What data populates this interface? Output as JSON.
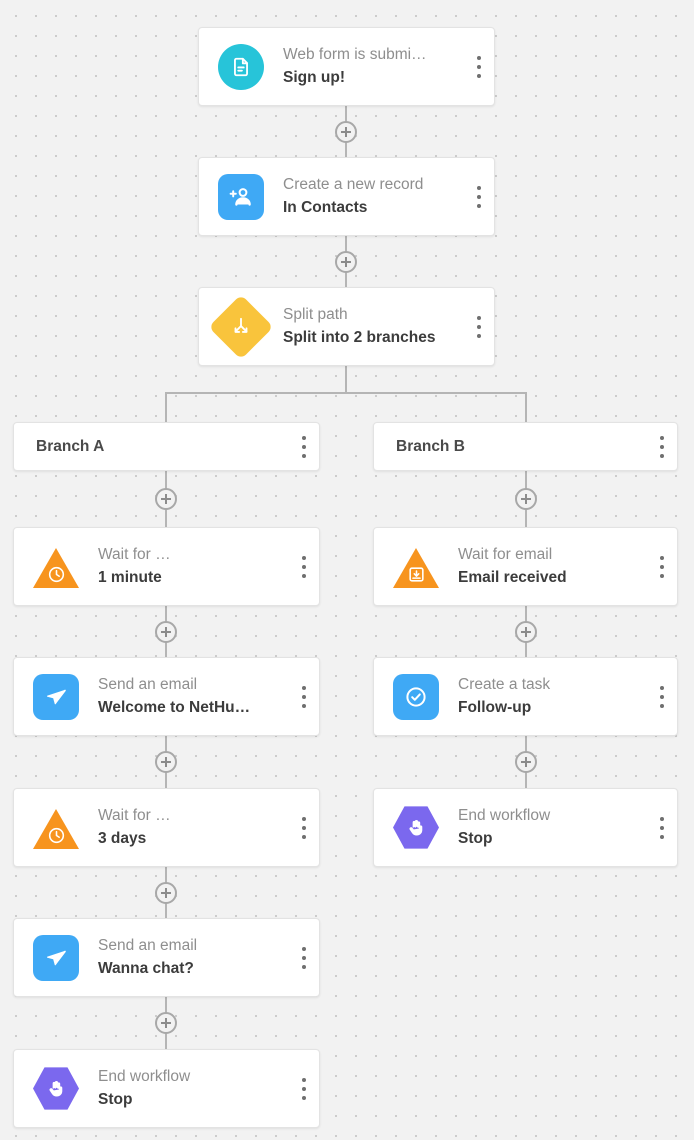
{
  "canvas": {
    "background_color": "#f2f2f2",
    "dot_color": "#c9c9c9",
    "connector_color": "#b5b5b5"
  },
  "icon_colors": {
    "web_form": "#27c4d9",
    "record": "#3fa9f5",
    "split": "#f9c council",
    "split_path": "#f9c43c",
    "wait": "#f7941e",
    "email": "#3fa9f5",
    "task": "#3fa9f5",
    "end": "#7b68ee"
  },
  "trunk": {
    "nodes": [
      {
        "id": "web-form",
        "subtitle": "Web form is submi…",
        "title": "Sign up!",
        "icon": "document-icon",
        "icon_shape": "circle",
        "icon_color": "#27c4d9"
      },
      {
        "id": "create-record",
        "subtitle": "Create a new record",
        "title": "In Contacts",
        "icon": "add-person-icon",
        "icon_shape": "rounded-square",
        "icon_color": "#3fa9f5"
      },
      {
        "id": "split-path",
        "subtitle": "Split path",
        "title": "Split into 2 branches",
        "icon": "split-arrows-icon",
        "icon_shape": "diamond",
        "icon_color": "#f9c43c"
      }
    ]
  },
  "branches": [
    {
      "id": "branch-a",
      "label": "Branch A",
      "nodes": [
        {
          "id": "wait-1-minute",
          "subtitle": "Wait for …",
          "title": "1 minute",
          "icon": "clock-icon",
          "icon_shape": "triangle",
          "icon_color": "#f7941e"
        },
        {
          "id": "send-email-welcome",
          "subtitle": "Send an email",
          "title": "Welcome to NetHu…",
          "icon": "paper-plane-icon",
          "icon_shape": "rounded-square",
          "icon_color": "#3fa9f5"
        },
        {
          "id": "wait-3-days",
          "subtitle": "Wait for …",
          "title": "3 days",
          "icon": "clock-icon",
          "icon_shape": "triangle",
          "icon_color": "#f7941e"
        },
        {
          "id": "send-email-chat",
          "subtitle": "Send an email",
          "title": "Wanna chat?",
          "icon": "paper-plane-icon",
          "icon_shape": "rounded-square",
          "icon_color": "#3fa9f5"
        },
        {
          "id": "end-workflow-a",
          "subtitle": "End workflow",
          "title": "Stop",
          "icon": "stop-hand-icon",
          "icon_shape": "hexagon",
          "icon_color": "#7b68ee"
        }
      ]
    },
    {
      "id": "branch-b",
      "label": "Branch B",
      "nodes": [
        {
          "id": "wait-for-email",
          "subtitle": "Wait for email",
          "title": "Email received",
          "icon": "inbox-tray-icon",
          "icon_shape": "triangle",
          "icon_color": "#f7941e"
        },
        {
          "id": "create-task",
          "subtitle": "Create a task",
          "title": "Follow-up",
          "icon": "check-circle-icon",
          "icon_shape": "rounded-square",
          "icon_color": "#3fa9f5"
        },
        {
          "id": "end-workflow-b",
          "subtitle": "End workflow",
          "title": "Stop",
          "icon": "stop-hand-icon",
          "icon_shape": "hexagon",
          "icon_color": "#7b68ee"
        }
      ]
    }
  ]
}
